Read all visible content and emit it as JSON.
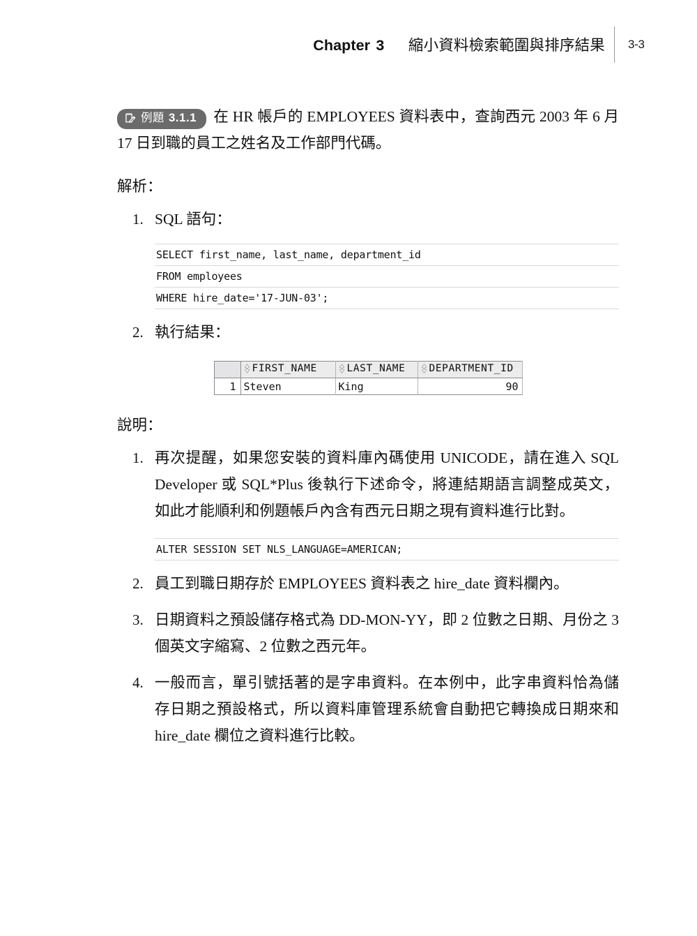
{
  "header": {
    "chapter_word": "Chapter",
    "chapter_number": "3",
    "chapter_title": "縮小資料檢索範圍與排序結果",
    "page_number": "3-3"
  },
  "example": {
    "badge_icon": "notepad-pencil-icon",
    "badge_label": "例題",
    "badge_number": "3.1.1",
    "text": "在 HR 帳戶的 EMPLOYEES 資料表中，查詢西元 2003 年 6 月 17 日到職的員工之姓名及工作部門代碼。"
  },
  "analysis": {
    "label": "解析：",
    "items": [
      {
        "marker": "1.",
        "text": "SQL 語句："
      },
      {
        "marker": "2.",
        "text": "執行結果："
      }
    ]
  },
  "sql_code": {
    "lines": [
      "SELECT first_name, last_name, department_id",
      "FROM employees",
      "WHERE hire_date='17-JUN-03';"
    ]
  },
  "result_grid": {
    "gutter_header": "",
    "columns": [
      {
        "name": "FIRST_NAME",
        "sort_icon": "sort-updown-icon"
      },
      {
        "name": "LAST_NAME",
        "sort_icon": "sort-updown-icon"
      },
      {
        "name": "DEPARTMENT_ID",
        "sort_icon": "sort-updown-icon"
      }
    ],
    "rows": [
      {
        "row_number": "1",
        "first_name": "Steven",
        "last_name": "King",
        "department_id": "90"
      }
    ]
  },
  "explanation": {
    "label": "說明：",
    "items": [
      {
        "marker": "1.",
        "text": "再次提醒，如果您安裝的資料庫內碼使用 UNICODE，請在進入 SQL Developer 或 SQL*Plus 後執行下述命令，將連結期語言調整成英文，如此才能順利和例題帳戶內含有西元日期之現有資料進行比對。"
      },
      {
        "marker": "2.",
        "text": "員工到職日期存於 EMPLOYEES 資料表之 hire_date 資料欄內。"
      },
      {
        "marker": "3.",
        "text": "日期資料之預設儲存格式為 DD-MON-YY，即 2 位數之日期、月份之 3 個英文字縮寫、2 位數之西元年。"
      },
      {
        "marker": "4.",
        "text": "一般而言，單引號括著的是字串資料。在本例中，此字串資料恰為儲存日期之預設格式，所以資料庫管理系統會自動把它轉換成日期來和 hire_date 欄位之資料進行比較。"
      }
    ]
  },
  "alter_code": {
    "lines": [
      "ALTER SESSION SET NLS_LANGUAGE=AMERICAN;"
    ]
  },
  "colors": {
    "badge_background": "#6b6b6b",
    "badge_text": "#ffffff",
    "code_rule": "#d8d8d8",
    "grid_header_background": "#ececed",
    "grid_border": "#8a8a8a"
  }
}
